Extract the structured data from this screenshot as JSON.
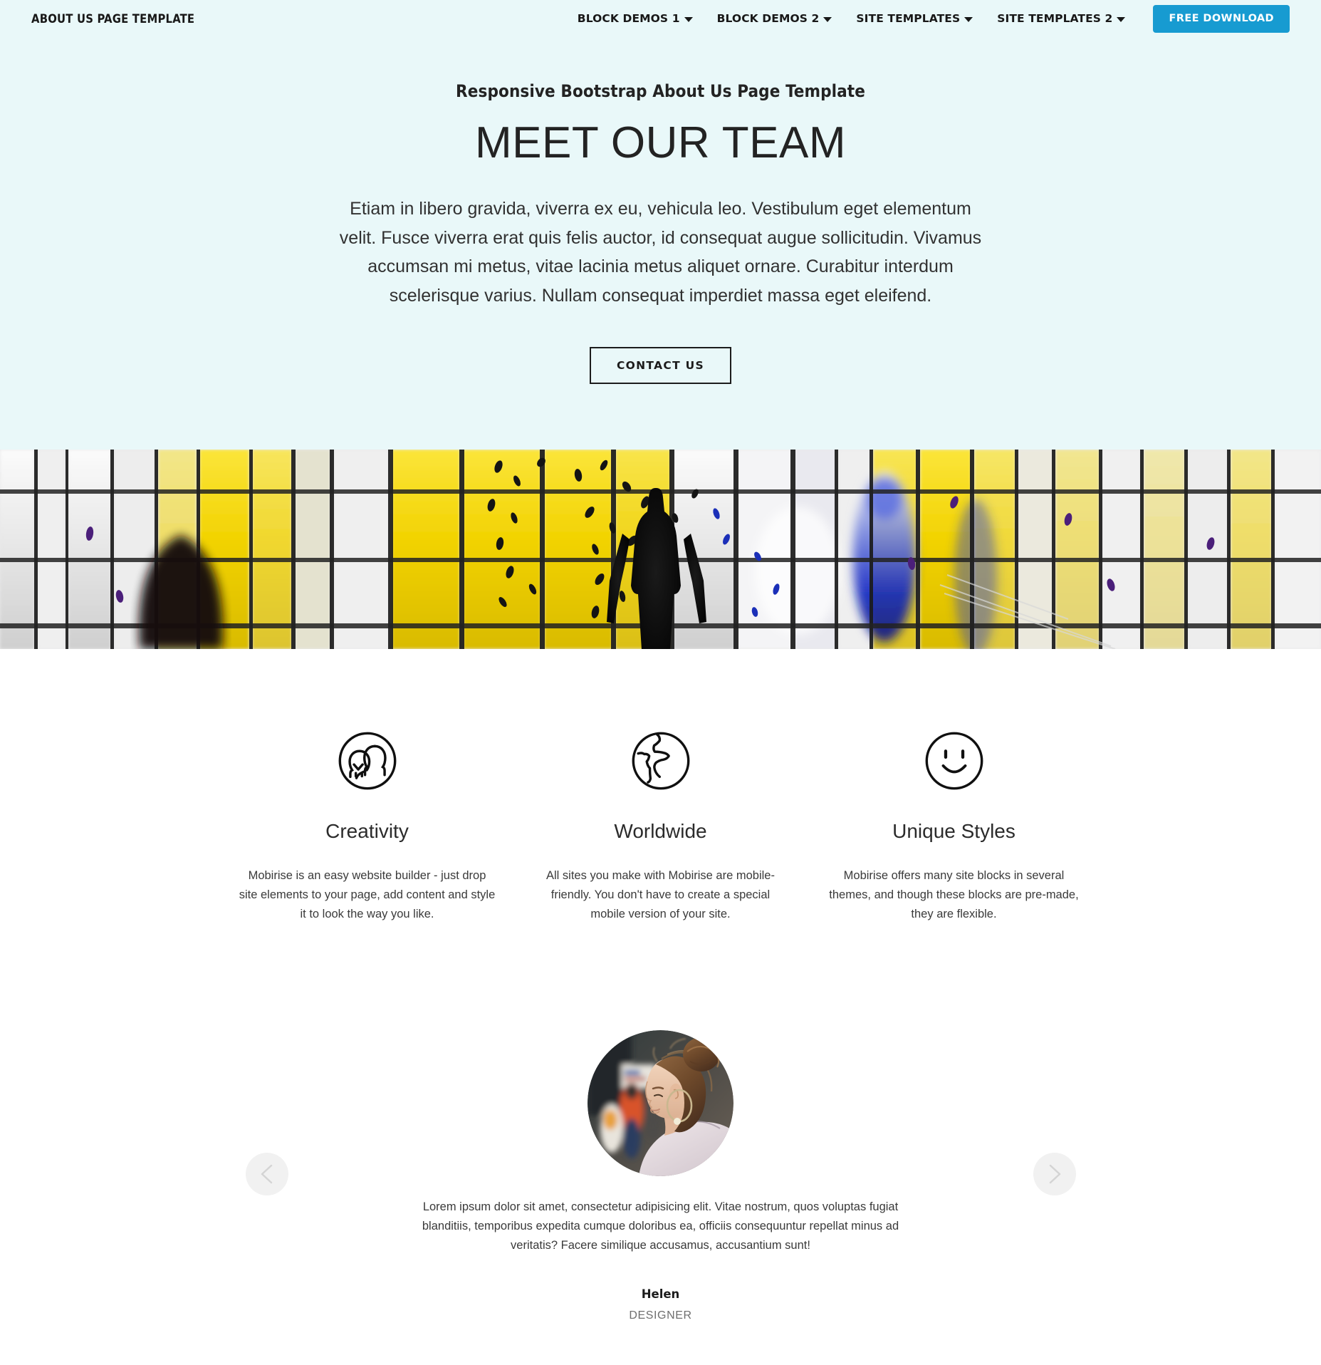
{
  "navbar": {
    "brand": "ABOUT US PAGE TEMPLATE",
    "items": [
      {
        "label": "BLOCK DEMOS 1",
        "caret": "chevron-down-icon"
      },
      {
        "label": "BLOCK DEMOS 2",
        "caret": "chevron-down-icon"
      },
      {
        "label": "SITE TEMPLATES",
        "caret": "chevron-down-icon"
      },
      {
        "label": "SITE TEMPLATES 2",
        "caret": "chevron-down-icon"
      }
    ],
    "download_label": "FREE DOWNLOAD",
    "download_color": "#179bd1",
    "background": "#e9f8f9"
  },
  "hero": {
    "kicker": "Responsive Bootstrap About Us Page Template",
    "title": "MEET OUR TEAM",
    "paragraph": "Etiam in libero gravida, viverra ex eu, vehicula leo. Vestibulum eget elementum velit. Fusce viverra erat quis felis auctor, id consequat augue sollicitudin. Vivamus accumsan mi metus, vitae lacinia metus aliquet ornare. Curabitur interdum scelerisque varius. Nullam consequat imperdiet massa eget eleifend.",
    "cta_label": "CONTACT US",
    "background": "#e9f8f9"
  },
  "banner": {
    "alt": "Backlit yellow and blue stained-glass style window wall with silhouetted figures",
    "colors": {
      "yellow": "#f2d302",
      "deep_yellow": "#e8c400",
      "blue": "#1327c4",
      "white": "#f3f3f3",
      "dark": "#161616",
      "purple": "#4b1f7a"
    }
  },
  "features": [
    {
      "icon": "people-icon",
      "title": "Creativity",
      "text": "Mobirise is an easy website builder - just drop site elements to your page, add content and style it to look the way you like."
    },
    {
      "icon": "globe-icon",
      "title": "Worldwide",
      "text": "All sites you make with Mobirise are mobile-friendly. You don't have to create a special mobile version of your site."
    },
    {
      "icon": "smiley-icon",
      "title": "Unique Styles",
      "text": "Mobirise offers many site blocks in several themes, and though these blocks are pre-made, they are flexible."
    }
  ],
  "testimonial": {
    "prev_icon": "chevron-left-icon",
    "next_icon": "chevron-right-icon",
    "avatar_alt": "Woman with a hair bun and hoop earring seen from behind",
    "quote": "Lorem ipsum dolor sit amet, consectetur adipisicing elit. Vitae nostrum, quos voluptas fugiat blanditiis, temporibus expedita cumque doloribus ea, officiis consequuntur repellat minus ad veritatis? Facere similique accusamus, accusantium sunt!",
    "author": "Helen",
    "role": "DESIGNER"
  }
}
